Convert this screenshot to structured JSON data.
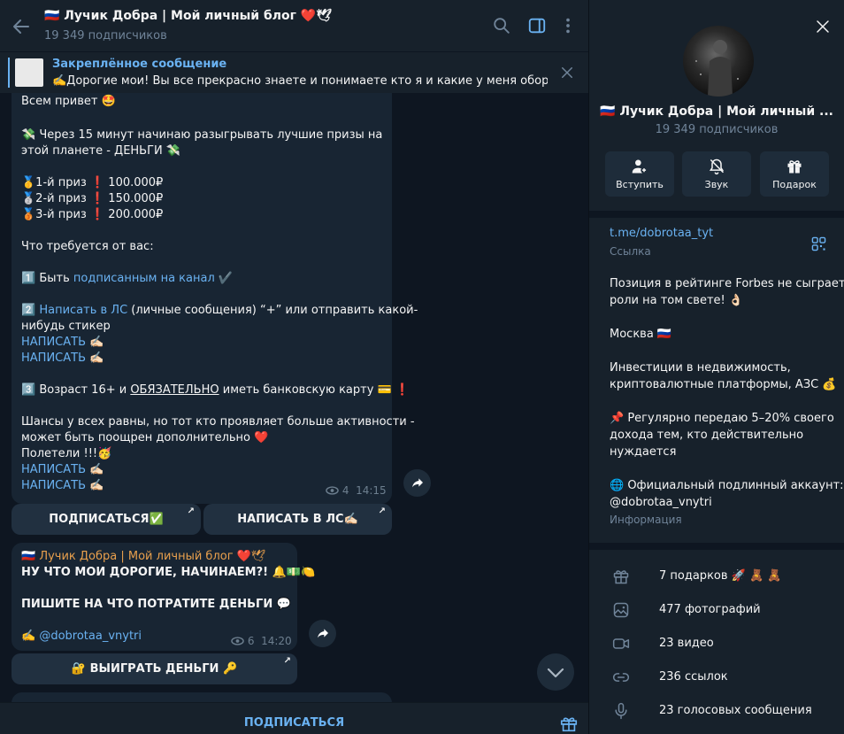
{
  "header": {
    "title": "🇷🇺 Лучик Добра | Мой личный блог ❤️🕊",
    "subscribers": "19 349 подписчиков"
  },
  "pinned": {
    "title": "Закреплённое сообщение",
    "text": "✍️Дорогие мои! Вы все прекрасно знаете и понимаете кто я и какие у меня обороты ..."
  },
  "message1": {
    "lines": [
      "Всем привет 🤩",
      "💸 Через 15 минут начинаю разыгрывать лучшие призы на",
      "этой планете - ДЕНЬГИ 💸",
      "🥇1-й приз ❗️ 100.000₽",
      "🥈2-й приз ❗️ 150.000₽",
      "🥉3-й приз ❗️ 200.000₽",
      "Что требуется от вас:",
      "1️⃣ Быть ",
      "подписанным на канал",
      " ✔️",
      "2️⃣ ",
      "Написать в ЛС",
      " (личные сообщения) “+” или отправить какой-",
      "нибудь стикер",
      "НАПИСАТЬ",
      " ✍🏻",
      "3️⃣ Возраст 16+ и ",
      "ОБЯЗАТЕЛЬНО",
      " иметь банковскую карту 💳 ❗️",
      "Шансы у всех равны, но тот кто проявляет больше активности -",
      "может быть поощрен дополнительно ❤️",
      "Полетели !!!🥳"
    ],
    "views": "4",
    "time": "14:15",
    "buttons": [
      "ПОДПИСАТЬСЯ✅",
      "НАПИСАТЬ В ЛС✍🏻"
    ]
  },
  "message2": {
    "author": "🇷🇺 Лучик Добра | Мой личный блог ❤️🕊",
    "line1": "НУ ЧТО МОИ ДОРОГИЕ, НАЧИНАЕМ?! 🔔💵🍋",
    "line2": "ПИШИТЕ НА ЧТО ПОТРАТИТЕ ДЕНЬГИ  💬",
    "signature_prefix": "✍️ ",
    "signature": "@dobrotaa_vnytri",
    "views": "6",
    "time": "14:20",
    "button": "🔐 ВЫИГРАТЬ ДЕНЬГИ 🔑"
  },
  "bottom": {
    "subscribe": "ПОДПИСАТЬСЯ"
  },
  "profile": {
    "name": "🇷🇺 Лучик Добра | Мой личный ...",
    "subscribers": "19 349 подписчиков",
    "actions": [
      "Вступить",
      "Звук",
      "Подарок"
    ],
    "link": "t.me/dobrotaa_tyt",
    "link_label": "Ссылка",
    "bio_lines": [
      "Позиция в рейтинге Forbes не сыграет",
      "роли на том свете! 👌🏻",
      "Москва 🇷🇺",
      "Инвестиции в недвижимость,",
      "криптовалютные платформы, АЗС 💰",
      "📌 Регулярно передаю 5–20% своего",
      "дохода тем, кто действительно",
      "нуждается",
      "🌐 Официальный подлинный аккаунт:",
      "@dobrotaa_vnytri"
    ],
    "info_label": "Информация",
    "media": [
      {
        "icon": "gift-icon",
        "label": "7 подарков 🚀 🧸 🧸"
      },
      {
        "icon": "photo-icon",
        "label": "477 фотографий"
      },
      {
        "icon": "video-icon",
        "label": "23 видео"
      },
      {
        "icon": "link-icon",
        "label": "236 ссылок"
      },
      {
        "icon": "mic-icon",
        "label": "23 голосовых сообщения"
      }
    ]
  },
  "colors": {
    "accent": "#6ab2f2",
    "bubble": "#182533",
    "panel": "#17212b",
    "background": "#0e1621"
  }
}
